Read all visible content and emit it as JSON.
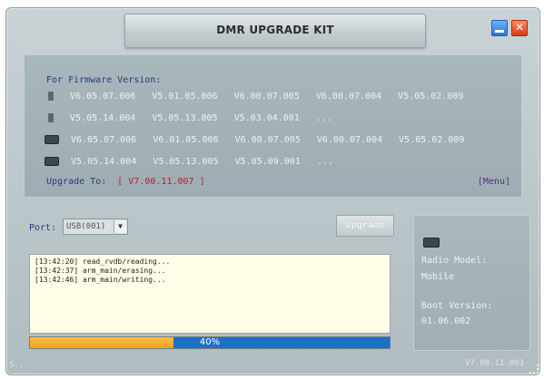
{
  "window": {
    "title": "DMR UPGRADE KIT",
    "close_label": "✕"
  },
  "firmware": {
    "heading": "For Firmware Version:",
    "radio_rows": [
      {
        "icon": "radio-icon",
        "versions": [
          "V6.05.07.006",
          "V5.01.05.006",
          "V6.00.07.005",
          "V6.00.07.004",
          "V5.05.02.009"
        ]
      },
      {
        "icon": "radio-icon",
        "versions": [
          "V5.05.14.004",
          "V5.05.13.005",
          "V5.03.04.001",
          "..."
        ]
      }
    ],
    "mobile_rows": [
      {
        "icon": "mobile-radio-icon",
        "versions": [
          "V6.05.07.006",
          "V6.01.05.006",
          "V6.00.07.005",
          "V6.00.07.004",
          "V5.05.02.009"
        ]
      },
      {
        "icon": "mobile-radio-icon",
        "versions": [
          "V5.05.14.004",
          "V5.05.13.005",
          "V5.05.09.001",
          "..."
        ]
      }
    ],
    "upgrade_to_label": "Upgrade To:",
    "upgrade_to_value": "[ V7.00.11.007 ]",
    "menu_label": "[Menu]"
  },
  "controls": {
    "port_label": "Port:",
    "port_value": "USB(001)",
    "upgrade_button": "Upgrade"
  },
  "log": {
    "lines": [
      "[13:42:20] read_rvdb/reading...",
      "[13:42:37] arm_main/erasing...",
      "[13:42:46] arm_main/writing..."
    ]
  },
  "progress": {
    "percent": 40,
    "label": "40%"
  },
  "device_info": {
    "icon": "mobile-radio-icon",
    "radio_model_label": "Radio Model:",
    "radio_model_value": "Mobile",
    "boot_version_label": "Boot Version:",
    "boot_version_value": "01.06.002"
  },
  "status": {
    "left_text": "S...",
    "right_text": "V7.00.11.003"
  },
  "colors": {
    "accent_blue": "#1f6fc6",
    "progress_orange": "#f2a020",
    "upgrade_to_red": "#c8182a",
    "label_navy": "#2b3a78"
  }
}
